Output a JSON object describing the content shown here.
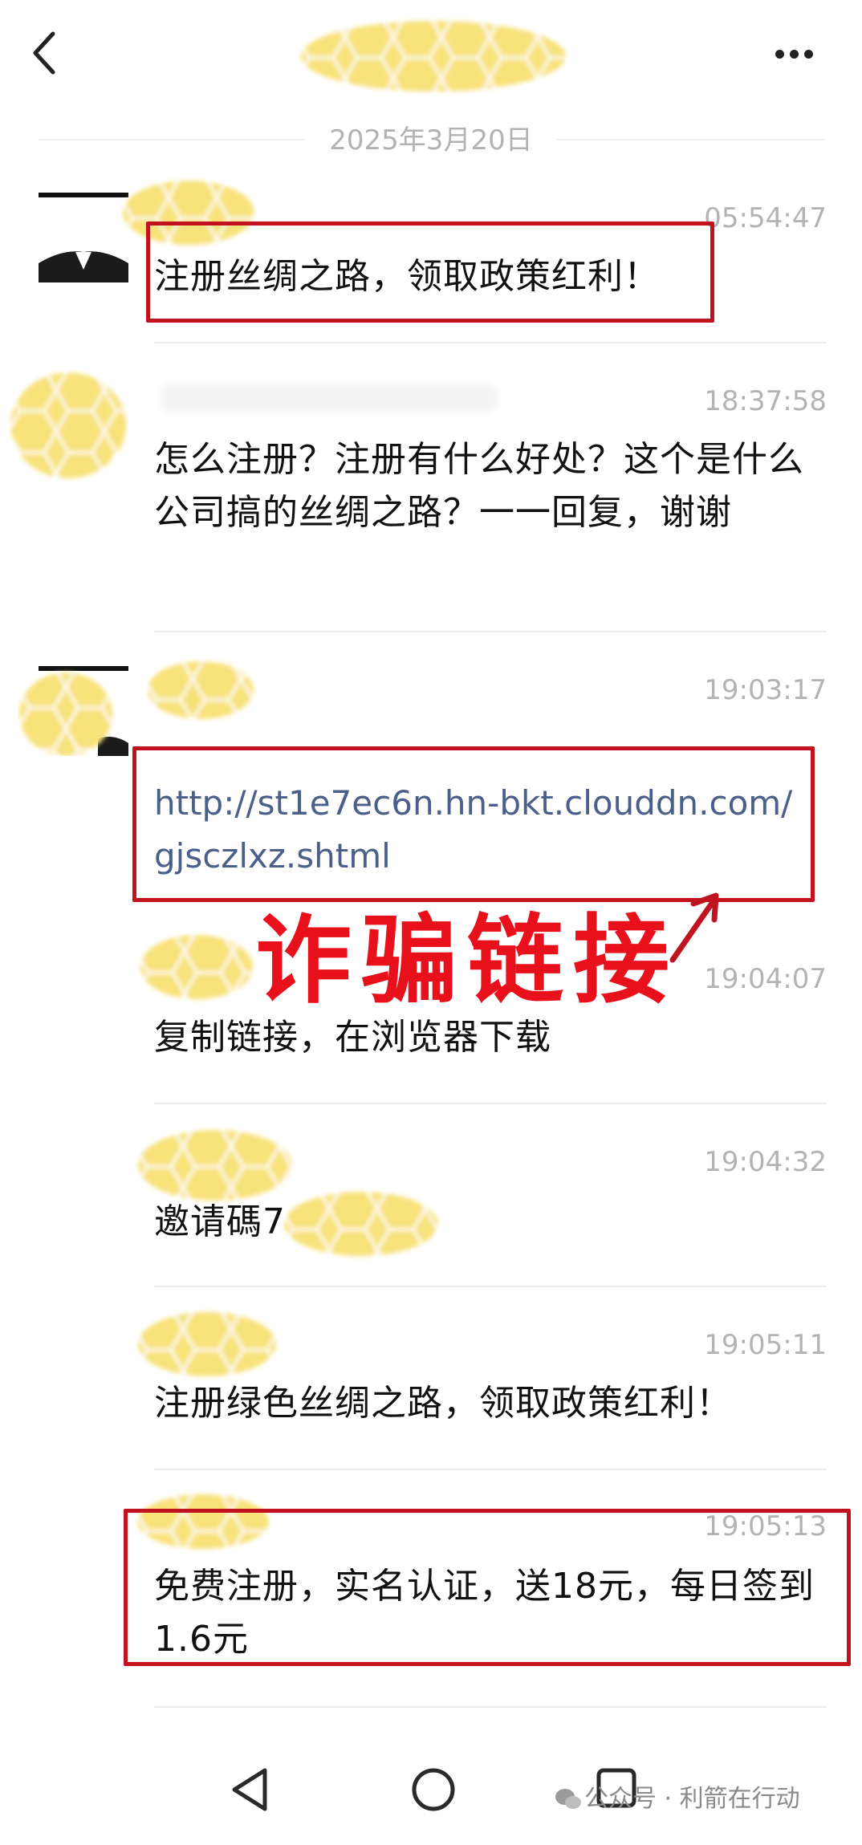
{
  "header": {
    "back_icon": "chevron-left-icon",
    "more_icon": "more-horizontal-icon"
  },
  "date_separator": "2025年3月20日",
  "messages": [
    {
      "time": "05:54:47",
      "text": "注册丝绸之路，领取政策红利！",
      "highlighted": true
    },
    {
      "time": "18:37:58",
      "text": "怎么注册？注册有什么好处？这个是什么公司搞的丝绸之路？一一回复，谢谢"
    },
    {
      "time": "19:03:17",
      "text": "http://st1e7ec6n.hn-bkt.clouddn.com/gjsczlxz.shtml",
      "highlighted": true
    },
    {
      "time": "19:04:07",
      "text": "复制链接，在浏览器下载"
    },
    {
      "time": "19:04:32",
      "text": "邀请碼7"
    },
    {
      "time": "19:05:11",
      "text": "注册绿色丝绸之路，领取政策红利！"
    },
    {
      "time": "19:05:13",
      "text": "免费注册，实名认证，送18元，每日签到1.6元",
      "highlighted": true
    }
  ],
  "annotation": {
    "label": "诈骗链接",
    "color": "#e8101a"
  },
  "nav": {
    "back": "triangle-back-icon",
    "home": "circle-home-icon",
    "recents": "square-recents-icon"
  },
  "watermark": "公众号 · 利箭在行动",
  "colors": {
    "redbox": "#c1121f",
    "blur": "#f8e27a",
    "link": "#4a5f8a"
  }
}
